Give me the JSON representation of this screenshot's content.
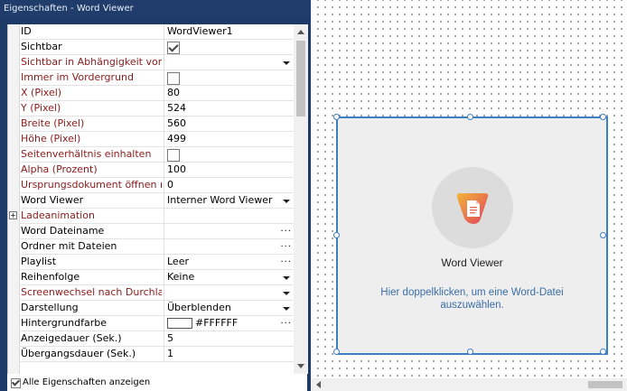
{
  "window": {
    "title": "Eigenschaften - Word Viewer"
  },
  "properties": [
    {
      "label": "ID",
      "value": "WordViewer1"
    },
    {
      "label": "Sichtbar",
      "checkbox": true
    },
    {
      "label": "Sichtbar in Abhängigkeit von",
      "value": ""
    },
    {
      "label": "Immer im Vordergrund",
      "checkbox": false
    },
    {
      "label": "X (Pixel)",
      "value": "80"
    },
    {
      "label": "Y (Pixel)",
      "value": "524"
    },
    {
      "label": "Breite (Pixel)",
      "value": "560"
    },
    {
      "label": "Höhe (Pixel)",
      "value": "499"
    },
    {
      "label": "Seitenverhältnis einhalten",
      "checkbox": false
    },
    {
      "label": "Alpha (Prozent)",
      "value": "100"
    },
    {
      "label": "Ursprungsdokument öffnen nach",
      "value": "0"
    },
    {
      "label": "Word Viewer",
      "value": "Interner Word Viewer"
    },
    {
      "label": "Ladeanimation",
      "value": ""
    },
    {
      "label": "Word Dateiname",
      "value": ""
    },
    {
      "label": "Ordner mit Dateien",
      "value": ""
    },
    {
      "label": "Playlist",
      "value": "Leer"
    },
    {
      "label": "Reihenfolge",
      "value": "Keine"
    },
    {
      "label": "Screenwechsel nach Durchlauf",
      "value": ""
    },
    {
      "label": "Darstellung",
      "value": "Überblenden"
    },
    {
      "label": "Hintergrundfarbe",
      "value": "#FFFFFF"
    },
    {
      "label": "Anzeigedauer (Sek.)",
      "value": "5"
    },
    {
      "label": "Übergangsdauer (Sek.)",
      "value": "1"
    }
  ],
  "footer": {
    "show_all_label": "Alle Eigenschaften anzeigen",
    "show_all_checked": true
  },
  "widget": {
    "title": "Word Viewer",
    "description": "Hier doppelklicken, um eine Word-Datei auszuwählen.",
    "icon": "word-document-icon"
  },
  "colors": {
    "panel_bg": "#1e3a66",
    "required_label": "#8b1a1a",
    "selection": "#3e7fc4",
    "hint_text": "#3a6ea8",
    "icon_gradient_start": "#f2b63b",
    "icon_gradient_end": "#e0405a"
  }
}
